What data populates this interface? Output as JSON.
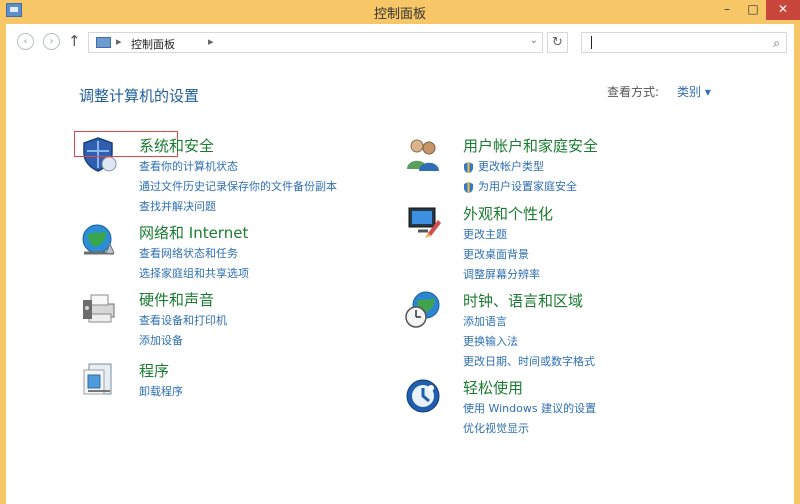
{
  "window": {
    "title": "控制面板",
    "min": "–",
    "max": "□",
    "close": "✕"
  },
  "toolbar": {
    "back": "‹",
    "forward": "›",
    "up": "↑",
    "breadcrumb": "控制面板",
    "separator": "▸",
    "dropdown": "⌄",
    "refresh": "↻",
    "search_value": "",
    "search_icon": "⌕"
  },
  "header": {
    "title": "调整计算机的设置",
    "view_by_label": "查看方式:",
    "view_by_value": "类别 ▾"
  },
  "left_categories": [
    {
      "title": "系统和安全",
      "links": [
        "查看你的计算机状态",
        "通过文件历史记录保存你的文件备份副本",
        "查找并解决问题"
      ]
    },
    {
      "title": "网络和 Internet",
      "links": [
        "查看网络状态和任务",
        "选择家庭组和共享选项"
      ]
    },
    {
      "title": "硬件和声音",
      "links": [
        "查看设备和打印机",
        "添加设备"
      ]
    },
    {
      "title": "程序",
      "links": [
        "卸载程序"
      ]
    }
  ],
  "right_categories": [
    {
      "title": "用户帐户和家庭安全",
      "links": [
        "更改帐户类型",
        "为用户设置家庭安全"
      ]
    },
    {
      "title": "外观和个性化",
      "links": [
        "更改主题",
        "更改桌面背景",
        "调整屏幕分辨率"
      ]
    },
    {
      "title": "时钟、语言和区域",
      "links": [
        "添加语言",
        "更换输入法",
        "更改日期、时间或数字格式"
      ]
    },
    {
      "title": "轻松使用",
      "links": [
        "使用 Windows 建议的设置",
        "优化视觉显示"
      ]
    }
  ]
}
